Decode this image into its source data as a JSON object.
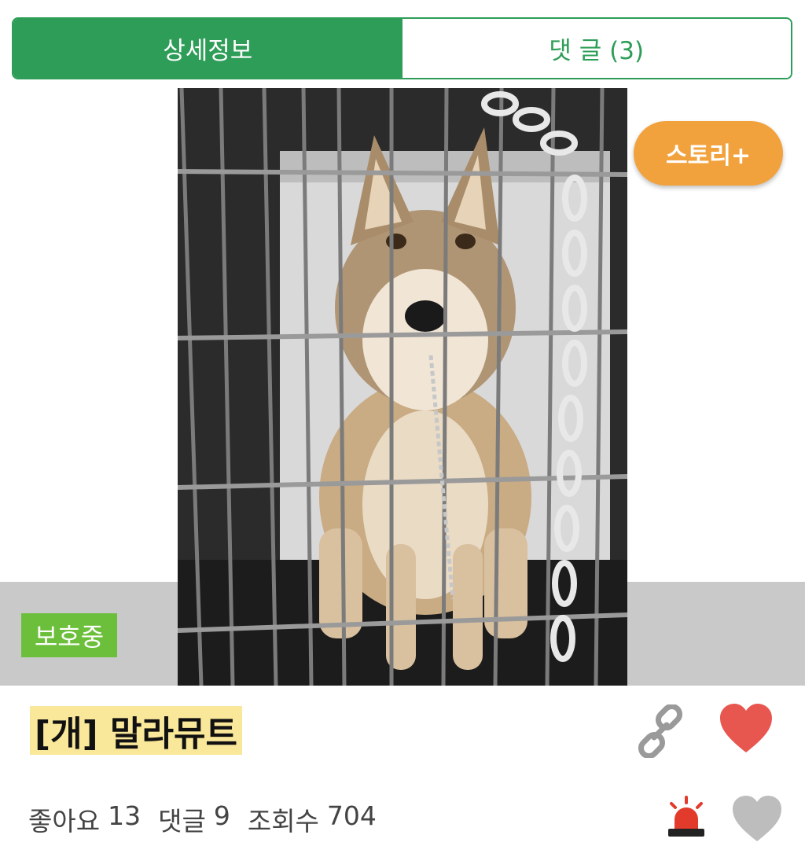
{
  "tabs": [
    {
      "label": "상세정보",
      "active": true
    },
    {
      "label": "댓 글 (3)",
      "active": false
    }
  ],
  "story_button": {
    "label": "스토리+"
  },
  "status_badge": "보호중",
  "title": "[개] 말라뮤트",
  "stats": {
    "likes_label": "좋아요",
    "likes": "13",
    "comments_label": "댓글",
    "comments": "9",
    "views_label": "조회수",
    "views": "704"
  },
  "icons": {
    "link": "link-icon",
    "like": "heart-icon",
    "report": "siren-icon",
    "favorite": "heart-outline-icon"
  },
  "colors": {
    "primary_green": "#2e9d57",
    "story_orange": "#f2a23d",
    "badge_green": "#6bbf3a",
    "title_highlight": "#f9e79a",
    "heart_red": "#e8574f",
    "siren_red": "#e23b2b"
  }
}
